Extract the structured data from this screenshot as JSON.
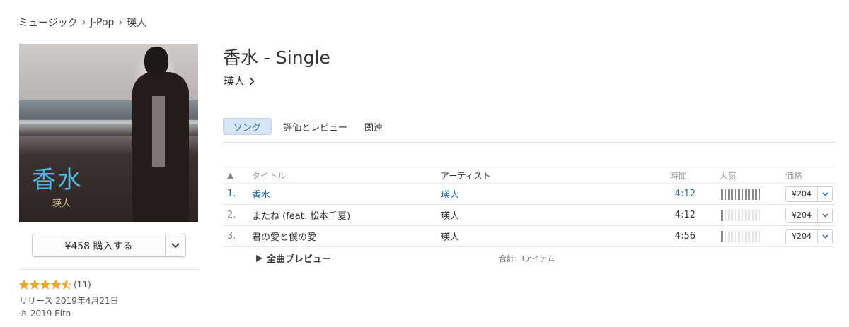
{
  "breadcrumb": {
    "items": [
      "ミュージック",
      "J-Pop",
      "瑛人"
    ]
  },
  "cover": {
    "title": "香水",
    "artist": "瑛人"
  },
  "buy": {
    "label": "¥458 購入する"
  },
  "rating": {
    "stars": 4.5,
    "count": "(11)"
  },
  "release": "リリース 2019年4月21日",
  "copyright": "℗ 2019 Eito",
  "album": {
    "title": "香水 - Single",
    "artist": "瑛人"
  },
  "tabs": [
    {
      "label": "ソング",
      "active": true
    },
    {
      "label": "評価とレビュー",
      "active": false
    },
    {
      "label": "関連",
      "active": false
    }
  ],
  "table": {
    "headers": {
      "sort": "▲",
      "title": "タイトル",
      "artist": "アーティスト",
      "time": "時間",
      "popularity": "人気",
      "price": "価格"
    },
    "rows": [
      {
        "num": "1.",
        "title": "香水",
        "artist": "瑛人",
        "time": "4:12",
        "popularity": 1.0,
        "price": "¥204"
      },
      {
        "num": "2.",
        "title": "またね (feat. 松本千夏)",
        "artist": "瑛人",
        "time": "4:12",
        "popularity": 0.1,
        "price": "¥204"
      },
      {
        "num": "3.",
        "title": "君の愛と僕の愛",
        "artist": "瑛人",
        "time": "4:56",
        "popularity": 0.1,
        "price": "¥204"
      }
    ]
  },
  "footer": {
    "preview": "全曲プレビュー",
    "total": "合計: 3アイテム"
  },
  "colors": {
    "accent": "#1e6eb3",
    "star": "#f0a526",
    "tab_active_bg": "#d7e6f4"
  }
}
